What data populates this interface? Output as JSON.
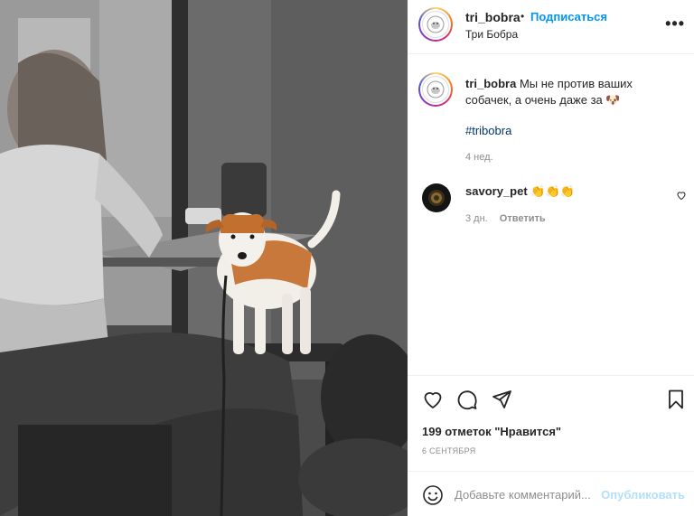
{
  "post": {
    "username": "tri_bobra",
    "dot": "•",
    "follow_label": "Подписаться",
    "location": "Три Бобра",
    "more_label": "•••"
  },
  "caption": {
    "username": "tri_bobra",
    "text": "Мы не против ваших собачек, а очень даже за 🐶",
    "hashtag": "#tribobra",
    "time": "4 нед."
  },
  "comment": {
    "username": "savory_pet",
    "text": "👏👏👏",
    "time": "3 дн.",
    "reply_label": "Ответить"
  },
  "stats": {
    "likes": "199 отметок \"Нравится\"",
    "date": "6 СЕНТЯБРЯ"
  },
  "add_comment": {
    "placeholder": "Добавьте комментарий...",
    "publish_label": "Опубликовать"
  },
  "icons": {
    "like": "heart-icon",
    "comment": "comment-icon",
    "share": "paper-plane-icon",
    "save": "bookmark-icon",
    "more": "more-icon",
    "emoji": "smiley-icon",
    "comment_like": "small-heart-icon"
  },
  "colors": {
    "link": "#0095f6",
    "hashtag": "#00376b",
    "muted": "#8e8e8e",
    "publish_disabled": "#b2dffc"
  }
}
